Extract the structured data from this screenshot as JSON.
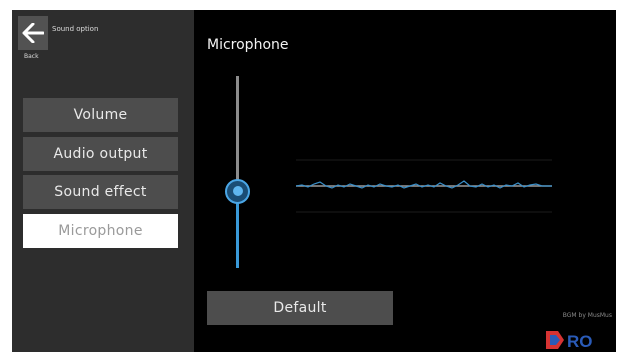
{
  "sidebar": {
    "title": "Sound option",
    "back_label": "Back",
    "items": [
      {
        "label": "Volume"
      },
      {
        "label": "Audio output"
      },
      {
        "label": "Sound effect"
      },
      {
        "label": "Microphone"
      }
    ],
    "active_item": "Microphone"
  },
  "main": {
    "title": "Microphone",
    "mic_level": 0.4,
    "default_label": "Default"
  },
  "footer": {
    "credit": "BGM by MusMus",
    "logo_text": "RO"
  },
  "colors": {
    "accent": "#3a9ad9",
    "sidebar_bg": "#2d2d2d",
    "button_bg": "#4d4d4d",
    "active_bg": "#ffffff",
    "logo_red": "#d63333",
    "logo_blue": "#2a5bb8"
  },
  "icons": {
    "back": "arrow-left-icon"
  }
}
